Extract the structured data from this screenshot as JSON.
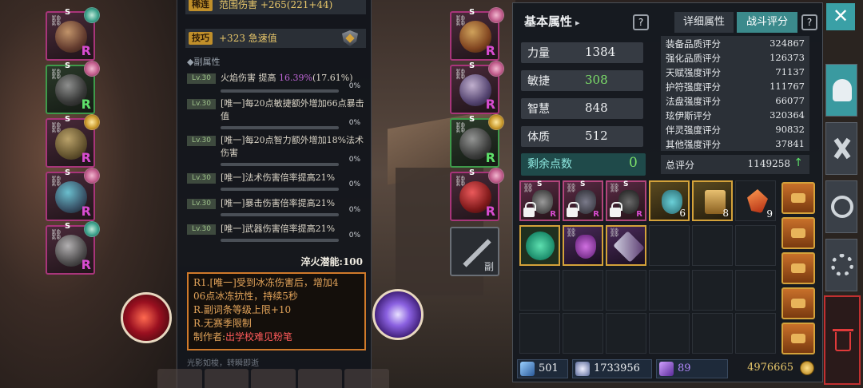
{
  "left_equipment": [
    {
      "name": "helmet",
      "rank": "R",
      "badge": "S",
      "medal": "teal",
      "frame": "purple"
    },
    {
      "name": "armor",
      "rank": "R",
      "badge": "S",
      "medal": "pink",
      "frame": "green"
    },
    {
      "name": "cloak",
      "rank": "R",
      "badge": "S",
      "medal": "gold",
      "frame": "purple"
    },
    {
      "name": "ring",
      "rank": "R",
      "badge": "S",
      "medal": "pink",
      "frame": "purple"
    },
    {
      "name": "scythe",
      "rank": "R",
      "badge": "S",
      "medal": "teal",
      "frame": "purple"
    }
  ],
  "right_equipment": [
    {
      "name": "amulet",
      "rank": "R",
      "badge": "S",
      "medal": "pink",
      "frame": "purple"
    },
    {
      "name": "gloves",
      "rank": "R",
      "badge": "S",
      "medal": "pink",
      "frame": "purple"
    },
    {
      "name": "boots",
      "rank": "R",
      "badge": "S",
      "medal": "gold",
      "frame": "green"
    },
    {
      "name": "ring2",
      "rank": "R",
      "badge": "S",
      "medal": "pink",
      "frame": "purple"
    }
  ],
  "sub_weapon": {
    "label": "副"
  },
  "detail": {
    "top_tag": "稀连",
    "top_text": "范围伤害 +265(221+44)",
    "skill_tag": "技巧",
    "skill_text": "+323 急速值",
    "sub_attr_title": "◆副属性",
    "affixes": [
      {
        "lv": "Lv.30",
        "text_pre": "火焰伤害 提高 ",
        "hl": "16.39%",
        "text_post": "(17.61%)",
        "pct": "0%"
      },
      {
        "lv": "Lv.30",
        "text_pre": "[唯一]每20点敏捷额外增加66点暴击值",
        "hl": "",
        "text_post": "",
        "pct": "0%"
      },
      {
        "lv": "Lv.30",
        "text_pre": "[唯一]每20点智力额外增加18%法术伤害",
        "hl": "",
        "text_post": "",
        "pct": "0%"
      },
      {
        "lv": "Lv.30",
        "text_pre": "[唯一]法术伤害倍率提高21%",
        "hl": "",
        "text_post": "",
        "pct": "0%"
      },
      {
        "lv": "Lv.30",
        "text_pre": "[唯一]暴击伤害倍率提高21%",
        "hl": "",
        "text_post": "",
        "pct": "0%"
      },
      {
        "lv": "Lv.30",
        "text_pre": "[唯一]武器伤害倍率提高21%",
        "hl": "",
        "text_post": "",
        "pct": "0%"
      }
    ],
    "potential": "淬火潜能:100",
    "note_lines": [
      "R1.[唯一]受到冰冻伤害后，增加4",
      "06点冰冻抗性，持续5秒",
      "R.副词条等级上限+10",
      "R.无赛季限制"
    ],
    "author_label": "制作者:",
    "author_name": "出学校难见粉笔",
    "fade_text": "光影如梭，转瞬即逝"
  },
  "attributes": {
    "title": "基本属性",
    "title_arrow": "▸",
    "tab_detail": "详细属性",
    "tab_combat": "战斗评分",
    "stats": [
      {
        "k": "力量",
        "v": "1384",
        "color": "white"
      },
      {
        "k": "敏捷",
        "v": "308",
        "color": "green"
      },
      {
        "k": "智慧",
        "v": "848",
        "color": "white"
      },
      {
        "k": "体质",
        "v": "512",
        "color": "white"
      }
    ],
    "points_label": "剩余点数",
    "points_value": "0",
    "scores": [
      {
        "n": "装备品质评分",
        "v": "324867"
      },
      {
        "n": "强化品质评分",
        "v": "126373"
      },
      {
        "n": "天赋强度评分",
        "v": "71137"
      },
      {
        "n": "护符强度评分",
        "v": "111767"
      },
      {
        "n": "法盘强度评分",
        "v": "66077"
      },
      {
        "n": "玹伊斯评分",
        "v": "320364"
      },
      {
        "n": "伴灵强度评分",
        "v": "90832"
      },
      {
        "n": "其他强度评分",
        "v": "37841"
      }
    ],
    "total_label": "总评分",
    "total_value": "1149258",
    "total_arrow": "↑"
  },
  "inventory": {
    "counts": [
      "6",
      "8",
      "9"
    ]
  },
  "currency": {
    "c1": "501",
    "c2": "1733956",
    "c3": "89",
    "gold": "4976665"
  },
  "rail": {
    "close": "✕"
  }
}
